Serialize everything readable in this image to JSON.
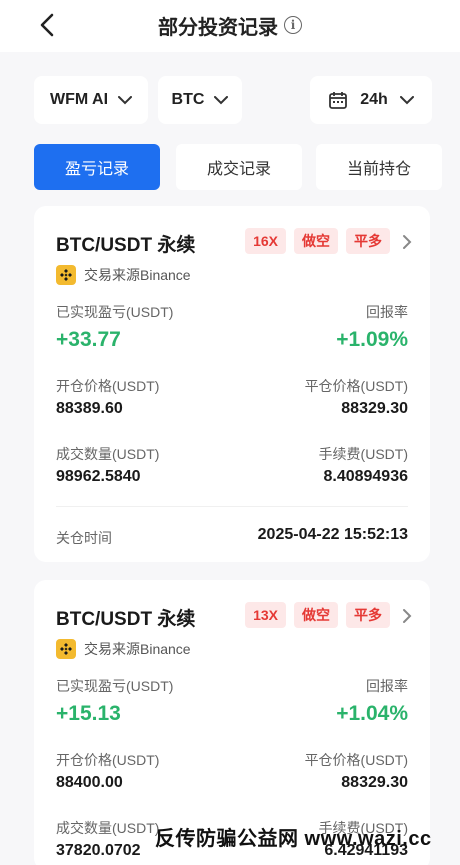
{
  "header": {
    "title": "部分投资记录",
    "info_icon": "info-icon",
    "back_icon": "chevron-left-icon"
  },
  "filters": {
    "strategy": "WFM AI",
    "coin": "BTC",
    "period": "24h",
    "calendar_icon": "calendar-icon"
  },
  "tabs": [
    {
      "label": "盈亏记录",
      "active": true
    },
    {
      "label": "成交记录",
      "active": false
    },
    {
      "label": "当前持仓",
      "active": false
    }
  ],
  "records": [
    {
      "pair": "BTC/USDT 永续",
      "leverage": "16X",
      "direction": "做空",
      "action": "平多",
      "source": "交易来源Binance",
      "pnl_label": "已实现盈亏(USDT)",
      "pnl": "+33.77",
      "roi_label": "回报率",
      "roi": "+1.09%",
      "open_label": "开仓价格(USDT)",
      "open_price": "88389.60",
      "close_label": "平仓价格(USDT)",
      "close_price": "88329.30",
      "qty_label": "成交数量(USDT)",
      "qty": "98962.5840",
      "fee_label": "手续费(USDT)",
      "fee": "8.40894936",
      "time_label": "关仓时间",
      "time": "2025-04-22 15:52:13"
    },
    {
      "pair": "BTC/USDT 永续",
      "leverage": "13X",
      "direction": "做空",
      "action": "平多",
      "source": "交易来源Binance",
      "pnl_label": "已实现盈亏(USDT)",
      "pnl": "+15.13",
      "roi_label": "回报率",
      "roi": "+1.04%",
      "open_label": "开仓价格(USDT)",
      "open_price": "88400.00",
      "close_label": "平仓价格(USDT)",
      "close_price": "88329.30",
      "qty_label": "成交数量(USDT)",
      "qty": "37820.0702",
      "fee_label": "手续费(USDT)",
      "fee": "6.42941193"
    }
  ],
  "watermark_footer": "反传防骗公益网 www.wazi.cc",
  "colors": {
    "accent": "#1e6ff0",
    "profit": "#2ab36b",
    "badge_text": "#e53935",
    "badge_bg": "#fde8e8"
  }
}
